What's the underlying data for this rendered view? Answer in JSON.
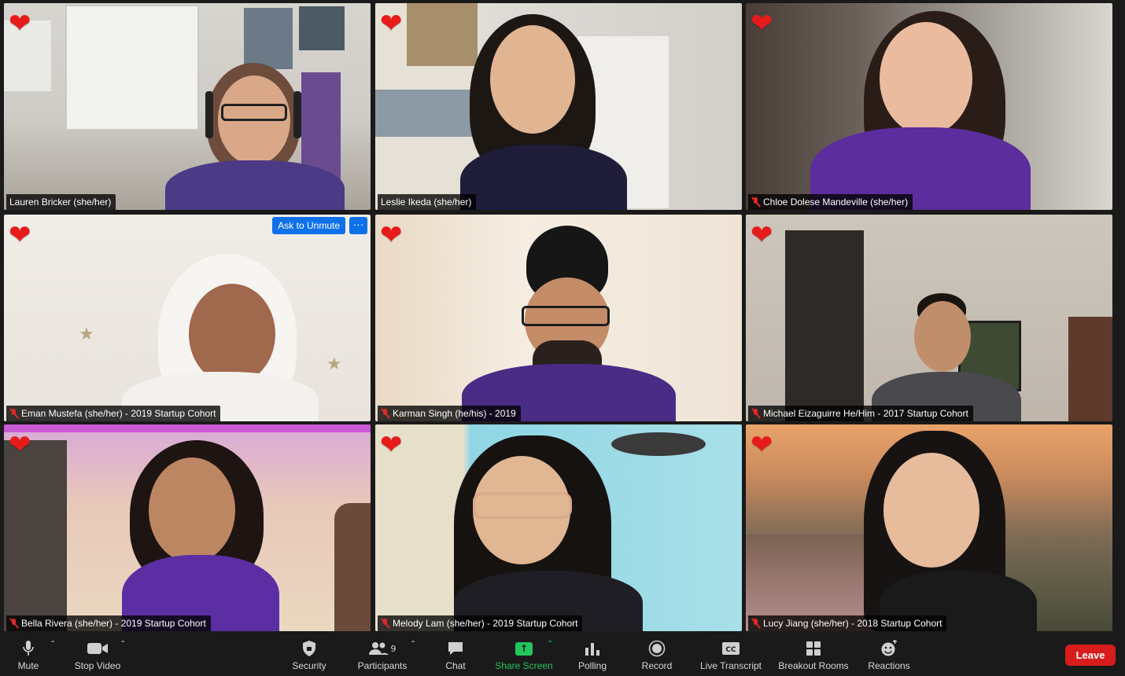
{
  "colors": {
    "active_speaker_border": "#cde56a",
    "heart": "#e81b1b",
    "muted_mic": "#e02828",
    "unmute_button": "#0e71eb",
    "share_screen": "#22c55e",
    "leave_button": "#d71c1c"
  },
  "tiles": [
    {
      "name": "Lauren Bricker (she/her)",
      "muted": false,
      "active_speaker": true
    },
    {
      "name": "Leslie Ikeda (she/her)",
      "muted": false,
      "active_speaker": false
    },
    {
      "name": "Chloe Dolese Mandeville (she/her)",
      "muted": true,
      "active_speaker": false
    },
    {
      "name": "Eman Mustefa (she/her) - 2019 Startup Cohort",
      "muted": true,
      "active_speaker": false,
      "ask_to_unmute": "Ask to Unmute",
      "more": "···"
    },
    {
      "name": "Karman Singh (he/his) - 2019",
      "muted": true,
      "active_speaker": false
    },
    {
      "name": "Michael Eizaguirre He/Him - 2017 Startup Cohort",
      "muted": true,
      "active_speaker": false
    },
    {
      "name": "Bella Rivera (she/her) - 2019 Startup Cohort",
      "muted": true,
      "active_speaker": false
    },
    {
      "name": "Melody Lam (she/her) - 2019 Startup Cohort",
      "muted": true,
      "active_speaker": false
    },
    {
      "name": "Lucy Jiang (she/her) - 2018 Startup Cohort",
      "muted": true,
      "active_speaker": false
    }
  ],
  "reaction_icon": "heart-icon",
  "toolbar": {
    "mute": "Mute",
    "stop_video": "Stop Video",
    "security": "Security",
    "participants": "Participants",
    "participants_count": "9",
    "chat": "Chat",
    "share_screen": "Share Screen",
    "polling": "Polling",
    "record": "Record",
    "live_transcript": "Live Transcript",
    "breakout_rooms": "Breakout Rooms",
    "reactions": "Reactions",
    "leave": "Leave"
  }
}
